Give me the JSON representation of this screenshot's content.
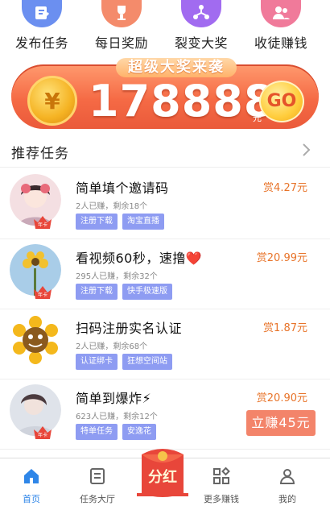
{
  "quick_nav": [
    {
      "label": "发布任务",
      "icon": "publish-task-icon",
      "color": "#6b8ff0"
    },
    {
      "label": "每日奖励",
      "icon": "trophy-icon",
      "color": "#f48b6b"
    },
    {
      "label": "裂变大奖",
      "icon": "share-network-icon",
      "color": "#a16bf0"
    },
    {
      "label": "收徒赚钱",
      "icon": "users-icon",
      "color": "#f07a9a"
    }
  ],
  "banner": {
    "tag": "超级大奖来袭",
    "amount": "178888",
    "unit": "元",
    "go_label": "GO",
    "coin_symbol": "¥"
  },
  "section": {
    "title": "推荐任务"
  },
  "tasks": [
    {
      "title": "简单填个邀请码",
      "meta": "2人已赚，剩余18个",
      "reward": "赏4.27元",
      "tags": [
        "注册下载",
        "淘宝直播"
      ],
      "badge": "年卡"
    },
    {
      "title": "看视频60秒，速撸❤️",
      "meta": "295人已赚，剩余32个",
      "reward": "赏20.99元",
      "tags": [
        "注册下载",
        "快手极速版"
      ],
      "badge": "年卡"
    },
    {
      "title": "扫码注册实名认证",
      "meta": "2人已赚，剩余68个",
      "reward": "赏1.87元",
      "tags": [
        "认证绑卡",
        "狂想空间站"
      ],
      "badge": ""
    },
    {
      "title": "简单到爆炸⚡",
      "meta": "623人已赚，剩余12个",
      "reward": "赏20.90元",
      "tags": [
        "特单任务",
        "安逸花"
      ],
      "badge": "年卡",
      "action": "立赚45元"
    }
  ],
  "tabbar": [
    {
      "label": "首页",
      "icon": "home-icon",
      "active": true
    },
    {
      "label": "任务大厅",
      "icon": "task-hall-icon",
      "active": false
    },
    {
      "label": "分红",
      "icon": "red-envelope-icon",
      "active": false
    },
    {
      "label": "更多赚钱",
      "icon": "more-apps-icon",
      "active": false
    },
    {
      "label": "我的",
      "icon": "profile-icon",
      "active": false
    }
  ],
  "colors": {
    "accent": "#2f86e8",
    "reward": "#e8742a",
    "tag": "#8e9cf2",
    "banner": "#f56a45"
  }
}
